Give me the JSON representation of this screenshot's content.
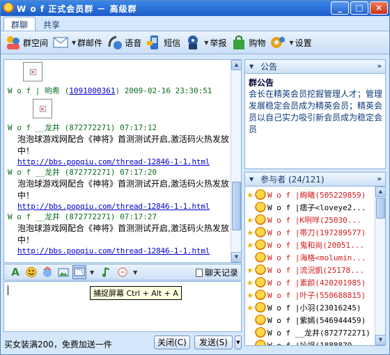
{
  "window": {
    "title": "W o f 正式会员群 － 高级群",
    "min_label": "_",
    "max_label": "□",
    "close_label": "×"
  },
  "tabs": [
    {
      "label": "群聊"
    },
    {
      "label": "共享"
    }
  ],
  "toolbar": {
    "items": [
      {
        "label": "群空间",
        "icon": "group-space-icon"
      },
      {
        "label": "群邮件",
        "icon": "mail-icon"
      },
      {
        "label": "语音",
        "icon": "voice-icon"
      },
      {
        "label": "短信",
        "icon": "sms-icon"
      },
      {
        "label": "举报",
        "icon": "report-icon"
      },
      {
        "label": "购物",
        "icon": "shopping-icon"
      },
      {
        "label": "设置",
        "icon": "settings-icon"
      }
    ]
  },
  "chat": {
    "messages": [
      {
        "sender": "W o f | 哟希",
        "id": "1091000361",
        "time": "2009-02-16 23:30:51",
        "type": "image"
      },
      {
        "sender": "W o f __龙井",
        "id": "872772271",
        "time": "07:17:12",
        "text": "泡泡球游戏网配合《神将》首测测试开启,激活码火热发放中！",
        "link": "http://bbs.popqiu.com/thread-12846-1-1.html"
      },
      {
        "sender": "W o f __龙井",
        "id": "872772271",
        "time": "07:17:20",
        "text": "泡泡球游戏网配合《神将》首测测试开启,激活码火热发放中！",
        "link": "http://bbs.popqiu.com/thread-12846-1-1.html"
      },
      {
        "sender": "W o f __龙井",
        "id": "872772271",
        "time": "07:17:27",
        "text": "泡泡球游戏网配合《神将》首测测试开启,激活码火热发放中！",
        "link": "http://bbs.popqiu.com/thread-12846-1-1.html"
      }
    ]
  },
  "format_bar": {
    "history_label": "聊天记录"
  },
  "tooltip": {
    "text": "捕捉屏幕 Ctrl + Alt + A"
  },
  "bottom": {
    "ad_text": "买女装满200，免费加送一件",
    "close_label": "关闭(C)",
    "send_label": "发送(S)"
  },
  "notice": {
    "header": "公告",
    "title": "群公告",
    "body": "会长在精英会员挖掘管理人才；管理发展稳定会员成为精英会员；精英会员以自己实力吸引新会员成为稳定会员"
  },
  "members": {
    "header": "参与者 (24/121)",
    "list": [
      {
        "name": "W o f |絢曦",
        "id": "(505229859)",
        "color": "#d41a1a",
        "star": true
      },
      {
        "name": "W o f |痞子",
        "id": "<loveye2...",
        "color": "#000000",
        "star": false
      },
      {
        "name": "W o f |K咧咩",
        "id": "(25030...",
        "color": "#d41a1a",
        "star": true
      },
      {
        "name": "W o f |帯刀",
        "id": "(197289577)",
        "color": "#d41a1a",
        "star": true
      },
      {
        "name": "W o f |鬼和尚",
        "id": "(20051...",
        "color": "#d41a1a",
        "star": true
      },
      {
        "name": "W o f |海格",
        "id": "<molumin...",
        "color": "#d41a1a",
        "star": false
      },
      {
        "name": "W o f |流況凱",
        "id": "(25178...",
        "color": "#d41a1a",
        "star": true
      },
      {
        "name": "W o f |素颜",
        "id": "(420201985)",
        "color": "#d41a1a",
        "star": true
      },
      {
        "name": "W o f |叶子",
        "id": "(550688815)",
        "color": "#d41a1a",
        "star": true
      },
      {
        "name": "W o f |小羽",
        "id": "(23016245)",
        "color": "#000000",
        "star": true
      },
      {
        "name": "W o f |紫嫣",
        "id": "(546944459)",
        "color": "#000000",
        "star": false
      },
      {
        "name": "W o f __龙井",
        "id": "(872772271)",
        "color": "#000000",
        "star": false
      },
      {
        "name": "W o f |訫誤",
        "id": "(1888879",
        "color": "#000000",
        "star": false
      }
    ]
  }
}
